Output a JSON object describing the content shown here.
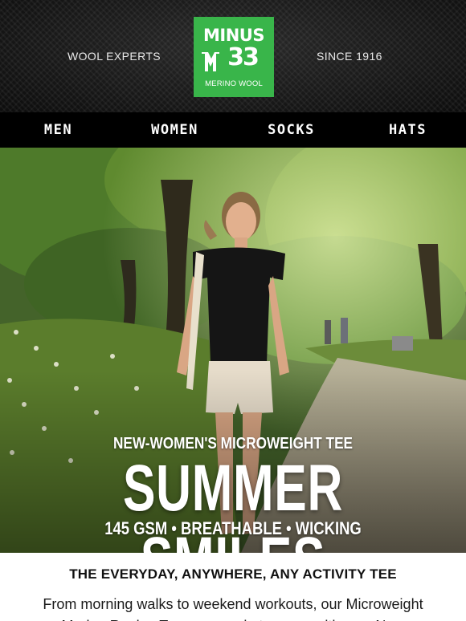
{
  "header": {
    "tagline_left": "WOOL EXPERTS",
    "tagline_right": "SINCE 1916",
    "logo": {
      "brand_top": "MINUS",
      "brand_num": "33",
      "brand_sub": "MERINO WOOL",
      "color": "#39b54a"
    }
  },
  "nav": {
    "items": [
      {
        "label": "MEN"
      },
      {
        "label": "WOMEN"
      },
      {
        "label": "SOCKS"
      },
      {
        "label": "HATS"
      }
    ]
  },
  "hero": {
    "image": "woman-walking-park-photo",
    "subtitle": "NEW-WOMEN'S MICROWEIGHT TEE",
    "title": "SUMMER SMILES",
    "specs": "145 GSM • BREATHABLE • WICKING"
  },
  "copy": {
    "heading": "THE EVERYDAY, ANYWHERE, ANY ACTIVITY TEE",
    "body": "From morning walks to weekend workouts, our Microweight Merino Raglan Tees are made to move with you. New"
  }
}
